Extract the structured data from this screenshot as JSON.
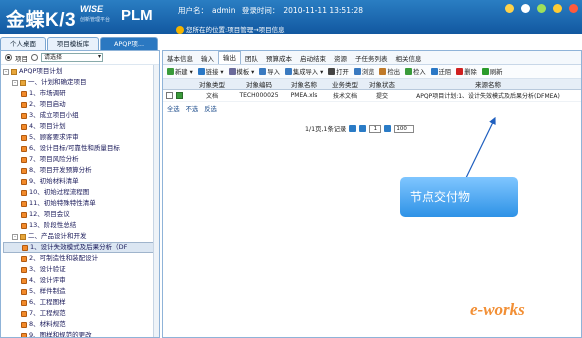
{
  "header": {
    "brand_main": "金蝶K/3",
    "brand_wise": "WISE",
    "brand_sub": "创新管理平台",
    "brand_plm": "PLM",
    "user_label": "用户名：",
    "user_name": "admin",
    "login_label": "登录时间：",
    "login_time": "2010-11-11 13:51:28",
    "icons": [
      {
        "name": "tools-icon",
        "color": "#ffd24a"
      },
      {
        "name": "help-icon",
        "color": "#ffffff"
      },
      {
        "name": "refresh-icon",
        "color": "#9fe05b"
      },
      {
        "name": "info-icon",
        "color": "#ffcc33"
      },
      {
        "name": "power-icon",
        "color": "#ff5a3c"
      }
    ]
  },
  "breadcrumb": {
    "prefix": "您所在的位置:",
    "path": "项目管理→项目信息"
  },
  "tabs": [
    {
      "label": "个人桌面",
      "active": false
    },
    {
      "label": "项目模板库",
      "active": false
    },
    {
      "label": "APQP项...",
      "active": true
    }
  ],
  "left_panel": {
    "radio_project": "项目",
    "select_placeholder": "请选择",
    "tree": [
      {
        "label": "APQP项目计划",
        "level": 0,
        "toggle": "-"
      },
      {
        "label": "一、计划和确定项目",
        "level": 1,
        "toggle": "-"
      },
      {
        "label": "1、市场调研",
        "level": 2
      },
      {
        "label": "2、项目启动",
        "level": 2
      },
      {
        "label": "3、成立项目小组",
        "level": 2
      },
      {
        "label": "4、项目计划",
        "level": 2
      },
      {
        "label": "5、顾客要求评审",
        "level": 2
      },
      {
        "label": "6、设计目标/可靠性和质量目标",
        "level": 2
      },
      {
        "label": "7、项目风险分析",
        "level": 2
      },
      {
        "label": "8、项目开发预算分析",
        "level": 2
      },
      {
        "label": "9、初始材料清单",
        "level": 2
      },
      {
        "label": "10、初始过程流程图",
        "level": 2
      },
      {
        "label": "11、初始特殊特性清单",
        "level": 2
      },
      {
        "label": "12、项目会议",
        "level": 2
      },
      {
        "label": "13、阶段性总结",
        "level": 2
      },
      {
        "label": "二、产品设计和开发",
        "level": 1,
        "toggle": "-"
      },
      {
        "label": "1、设计失效模式及后果分析（DF",
        "level": 2,
        "selected": true
      },
      {
        "label": "2、可制造性和装配设计",
        "level": 2
      },
      {
        "label": "3、设计验证",
        "level": 2
      },
      {
        "label": "4、设计评审",
        "level": 2
      },
      {
        "label": "5、样件制造",
        "level": 2
      },
      {
        "label": "6、工程图样",
        "level": 2
      },
      {
        "label": "7、工程规范",
        "level": 2
      },
      {
        "label": "8、材料规范",
        "level": 2
      },
      {
        "label": "9、图样和规范的更改",
        "level": 2
      }
    ]
  },
  "subtabs": [
    "基本信息",
    "输入",
    "输出",
    "团队",
    "预算成本",
    "启动结束",
    "资源",
    "子任务列表",
    "相关信息"
  ],
  "active_subtab": "输出",
  "toolbar": [
    {
      "label": "新建 ▾",
      "icon": "new-icon",
      "color": "#3a9b3a"
    },
    {
      "label": "链接 ▾",
      "icon": "link-icon",
      "color": "#2a78c6"
    },
    {
      "label": "模板 ▾",
      "icon": "template-icon",
      "color": "#6a6a9a"
    },
    {
      "label": "导入",
      "icon": "import-icon",
      "color": "#3a7ac0"
    },
    {
      "label": "集成导入 ▾",
      "icon": "batch-import-icon",
      "color": "#3a7ac0"
    },
    {
      "label": "打开",
      "icon": "open-icon",
      "color": "#444"
    },
    {
      "label": "浏览",
      "icon": "browse-icon",
      "color": "#3a7ac0"
    },
    {
      "label": "检出",
      "icon": "checkout-icon",
      "color": "#c07a2a"
    },
    {
      "label": "检入",
      "icon": "checkin-icon",
      "color": "#3a9b3a"
    },
    {
      "label": "迁阻",
      "icon": "move-icon",
      "color": "#2a78c6"
    },
    {
      "label": "删除",
      "icon": "delete-icon",
      "color": "#d02020"
    },
    {
      "label": "刷新",
      "icon": "refresh-icon",
      "color": "#2a9b2a"
    }
  ],
  "grid": {
    "columns": [
      "对象类型",
      "对象编码",
      "对象名称",
      "业务类型",
      "对象状态",
      "来源名称"
    ],
    "rows": [
      [
        "文档",
        "TECH000025",
        "PMEA.xls",
        "技术文档",
        "提交",
        "APQP项目计划:1、设计失效模式及后果分析(DFMEA)"
      ]
    ]
  },
  "selection": [
    "全选",
    "不选",
    "反选"
  ],
  "pager": {
    "summary": "1/1页,1条记录",
    "page": "1",
    "page_size": "100"
  },
  "annotation": "节点交付物",
  "watermark": "e-works"
}
